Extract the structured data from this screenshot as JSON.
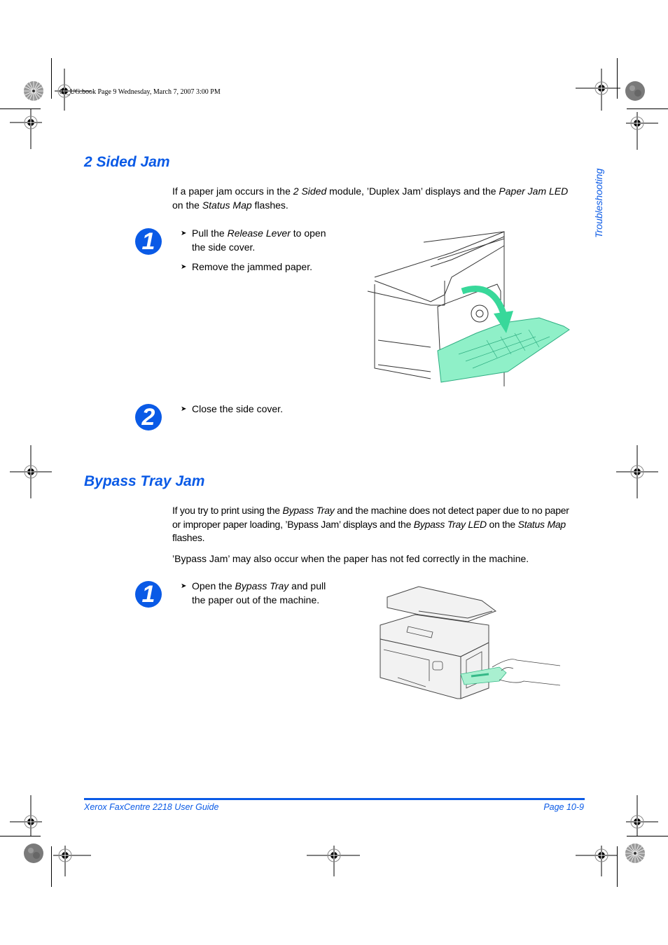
{
  "book_header": "01_UG.book  Page 9  Wednesday, March 7, 2007  3:00 PM",
  "side_tab": "Troubleshooting",
  "sections": [
    {
      "title": "2 Sided Jam",
      "intro": {
        "t1": "If a paper jam occurs in the ",
        "i1": "2 Sided",
        "t2": " module, ’Duplex Jam’ displays and the ",
        "i2": "Paper Jam LED",
        "t3": "on the ",
        "i3": "Status Map",
        "t4": " flashes."
      },
      "steps": [
        {
          "number": "1",
          "bullets": [
            {
              "t1": "Pull the ",
              "i1": "Release Lever",
              "t2": " to open",
              "line2": "the side cover."
            },
            {
              "t1": "Remove the jammed paper."
            }
          ],
          "illustration": "side-cover-open-illustration"
        },
        {
          "number": "2",
          "bullets": [
            {
              "t1": "Close the side cover."
            }
          ]
        }
      ]
    },
    {
      "title": "Bypass Tray Jam",
      "intro": {
        "l1_t1": "If you try to print using the ",
        "l1_i1": "Bypass Tray",
        "l1_t2": " and the machine does not detect paper due to no paper",
        "l2_t1": "or improper paper loading, ’Bypass Jam’ displays and the ",
        "l2_i1": "Bypass Tray LED",
        "l2_t2": " on the ",
        "l2_i2": "Status Map",
        "l3": "flashes.",
        "p2": "’Bypass Jam’ may also occur when the paper has not fed correctly in the machine."
      },
      "steps": [
        {
          "number": "1",
          "bullets": [
            {
              "t1": "Open the ",
              "i1": "Bypass Tray",
              "t2": " and pull",
              "line2": "the paper out of the machine."
            }
          ],
          "illustration": "bypass-tray-illustration"
        }
      ]
    }
  ],
  "footer": {
    "left": "Xerox FaxCentre 2218 User Guide",
    "right": "Page 10-9"
  },
  "colors": {
    "accent": "#0a5ae6",
    "illustration_green": "#8ff0c8"
  }
}
